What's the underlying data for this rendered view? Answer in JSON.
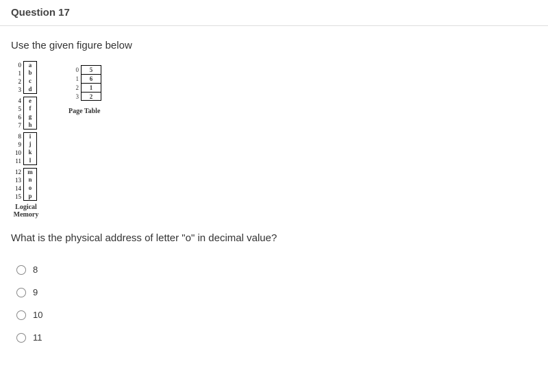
{
  "header": {
    "title": "Question 17"
  },
  "instruction": "Use the given figure below",
  "logical_memory": {
    "label": "Logical\nMemory",
    "groups": [
      [
        {
          "idx": "0",
          "val": "a"
        },
        {
          "idx": "1",
          "val": "b"
        },
        {
          "idx": "2",
          "val": "c"
        },
        {
          "idx": "3",
          "val": "d"
        }
      ],
      [
        {
          "idx": "4",
          "val": "e"
        },
        {
          "idx": "5",
          "val": "f"
        },
        {
          "idx": "6",
          "val": "g"
        },
        {
          "idx": "7",
          "val": "h"
        }
      ],
      [
        {
          "idx": "8",
          "val": "i"
        },
        {
          "idx": "9",
          "val": "j"
        },
        {
          "idx": "10",
          "val": "k"
        },
        {
          "idx": "11",
          "val": "l"
        }
      ],
      [
        {
          "idx": "12",
          "val": "m"
        },
        {
          "idx": "13",
          "val": "n"
        },
        {
          "idx": "14",
          "val": "o"
        },
        {
          "idx": "15",
          "val": "p"
        }
      ]
    ]
  },
  "page_table": {
    "label": "Page Table",
    "rows": [
      {
        "idx": "0",
        "val": "5"
      },
      {
        "idx": "1",
        "val": "6"
      },
      {
        "idx": "2",
        "val": "1"
      },
      {
        "idx": "3",
        "val": "2"
      }
    ]
  },
  "question": "What is the physical address of letter \"o\" in decimal value?",
  "options": [
    "8",
    "9",
    "10",
    "11"
  ]
}
